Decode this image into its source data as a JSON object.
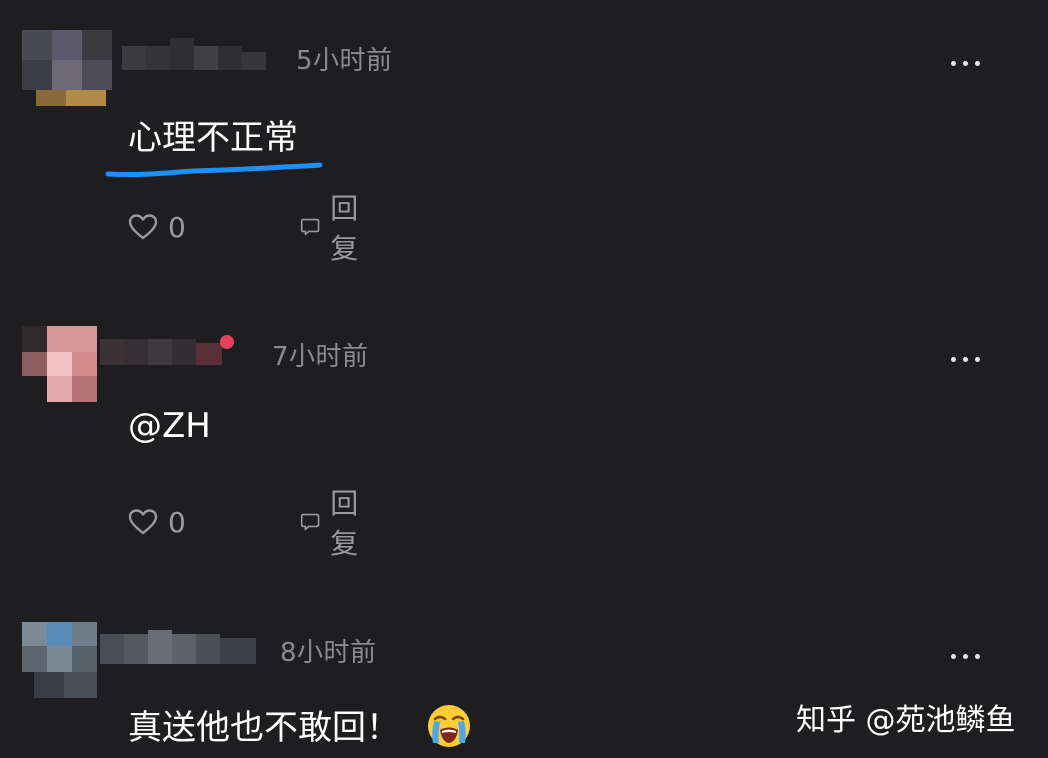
{
  "comments": [
    {
      "time": "5小时前",
      "text": "心理不正常",
      "likes": "0",
      "reply_label": "回复"
    },
    {
      "time": "7小时前",
      "text": "@ZH",
      "likes": "0",
      "reply_label": "回复"
    },
    {
      "time": "8小时前",
      "text": "真送他也不敢回！"
    }
  ],
  "icons": {
    "like": "heart-outline-icon",
    "reply": "speech-bubble-icon",
    "more": "ellipsis-icon",
    "emoji": "loudly-crying-face-emoji"
  },
  "colors": {
    "background": "#1e1e20",
    "meta_text": "#8b8b8f",
    "highlight_underline": "#1e8fff"
  },
  "watermark": "知乎 @苑池鳞鱼"
}
